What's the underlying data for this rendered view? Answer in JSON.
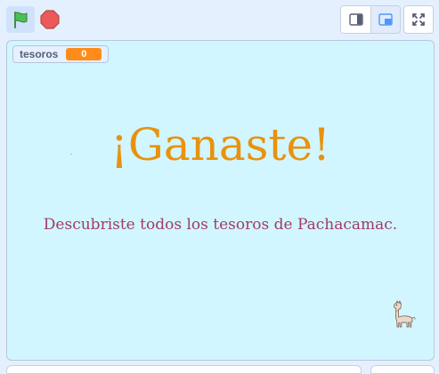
{
  "toolbar": {
    "green_flag_icon": "green-flag-icon",
    "stop_icon": "stop-icon",
    "small_stage_icon": "small-stage-icon",
    "large_stage_icon": "large-stage-icon",
    "fullscreen_icon": "fullscreen-icon",
    "active_view": "large-stage"
  },
  "stage": {
    "variable_monitor": {
      "label": "tesoros",
      "value": "0"
    },
    "title": "¡Ganaste!",
    "message": "Descubriste todos los tesoros de Pachacamac.",
    "sprite": "llama-icon"
  },
  "colors": {
    "accent": "#4c97ff",
    "stage_bg": "#d2f6ff",
    "title": "#e8920f",
    "message": "#a23a68",
    "monitor_value": "#ff8c1a",
    "flag": "#4cbf56",
    "stop": "#ec5959"
  }
}
